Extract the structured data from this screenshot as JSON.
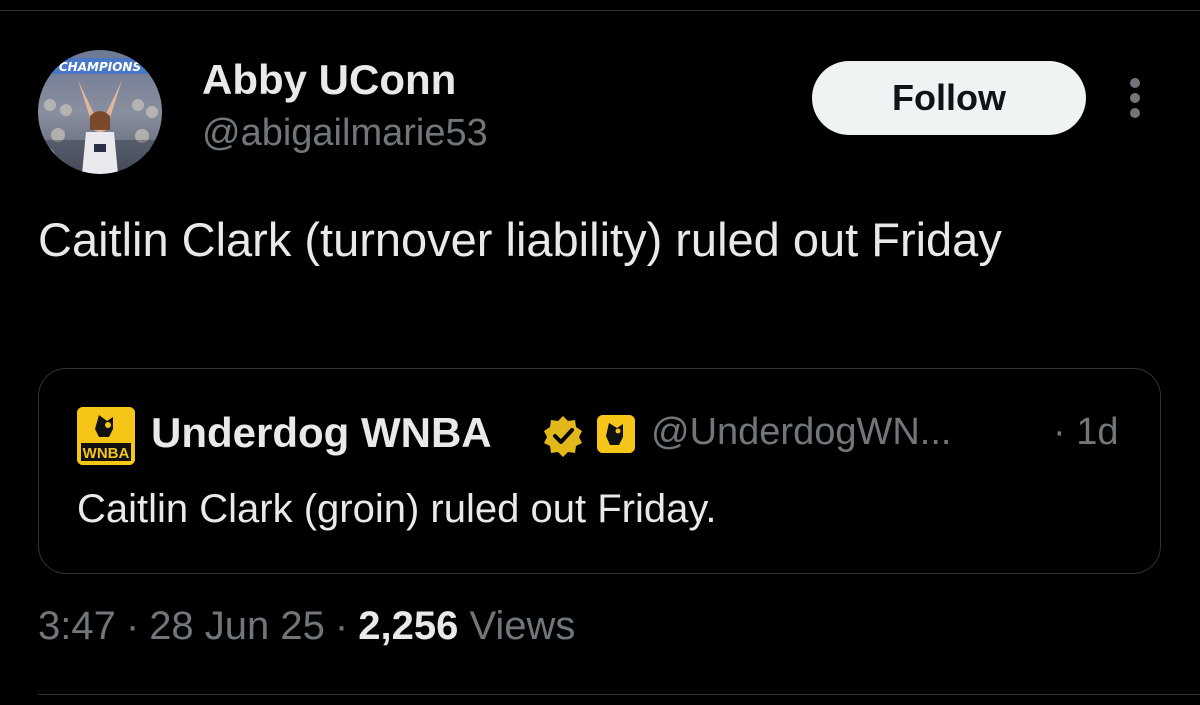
{
  "author": {
    "name": "Abby UConn",
    "handle": "@abigailmarie53",
    "avatar_banner_text": "CHAMPIONS"
  },
  "follow_button": {
    "label": "Follow"
  },
  "more_icon": "more-vertical-icon",
  "tweet": {
    "text": "Caitlin Clark (turnover liability) ruled out Friday"
  },
  "quote": {
    "author_name": "Underdog WNBA",
    "handle": "@UnderdogWN...",
    "time": "· 1d",
    "text": "Caitlin Clark (groin) ruled out Friday.",
    "avatar_text": "WNBA",
    "verified_icon": "verified-badge-icon",
    "affiliate_icon": "affiliate-badge-icon"
  },
  "meta": {
    "time": "3:47",
    "date": "28 Jun 25",
    "views_count": "2,256",
    "views_label": "Views",
    "separator": "·"
  },
  "colors": {
    "background": "#000000",
    "text_primary": "#e7e9ea",
    "text_secondary": "#71767b",
    "border": "#2f3336",
    "follow_bg": "#eff3f4",
    "brand_yellow": "#f5c518",
    "verified_gold": "#e2b719"
  }
}
